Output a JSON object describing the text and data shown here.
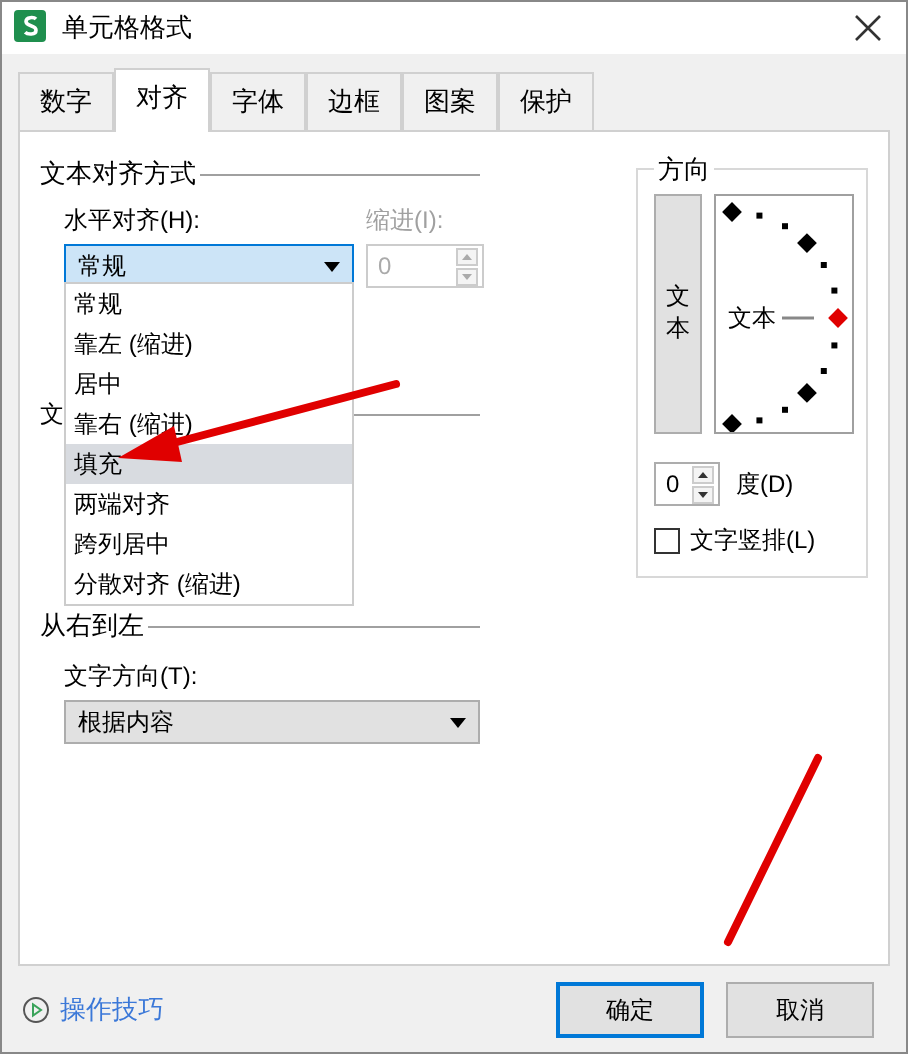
{
  "window": {
    "title": "单元格格式"
  },
  "tabs": [
    {
      "label": "数字",
      "selected": false
    },
    {
      "label": "对齐",
      "selected": true
    },
    {
      "label": "字体",
      "selected": false
    },
    {
      "label": "边框",
      "selected": false
    },
    {
      "label": "图案",
      "selected": false
    },
    {
      "label": "保护",
      "selected": false
    }
  ],
  "alignment": {
    "legend": "文本对齐方式",
    "horizontal_label": "水平对齐(H):",
    "horizontal_value": "常规",
    "indent_label": "缩进(I):",
    "indent_value": "0",
    "indent_disabled": true
  },
  "dropdown": {
    "items": [
      {
        "label": "常规",
        "selected": false
      },
      {
        "label": "靠左 (缩进)",
        "selected": false
      },
      {
        "label": "居中",
        "selected": false
      },
      {
        "label": "靠右 (缩进)",
        "selected": false
      },
      {
        "label": "填充",
        "selected": true
      },
      {
        "label": "两端对齐",
        "selected": false
      },
      {
        "label": "跨列居中",
        "selected": false
      },
      {
        "label": "分散对齐 (缩进)",
        "selected": false
      }
    ]
  },
  "text_control": {
    "legend": "文"
  },
  "rtl": {
    "legend": "从右到左",
    "direction_label": "文字方向(T):",
    "direction_value": "根据内容"
  },
  "orientation": {
    "legend": "方向",
    "vertical_text": "文本",
    "dial_text": "文本",
    "degrees_value": "0",
    "degrees_label": "度(D)",
    "vertical_checkbox": {
      "label": "文字竖排(L)",
      "checked": false
    }
  },
  "footer": {
    "tips": "操作技巧",
    "buttons": [
      "确定",
      "取消"
    ]
  }
}
